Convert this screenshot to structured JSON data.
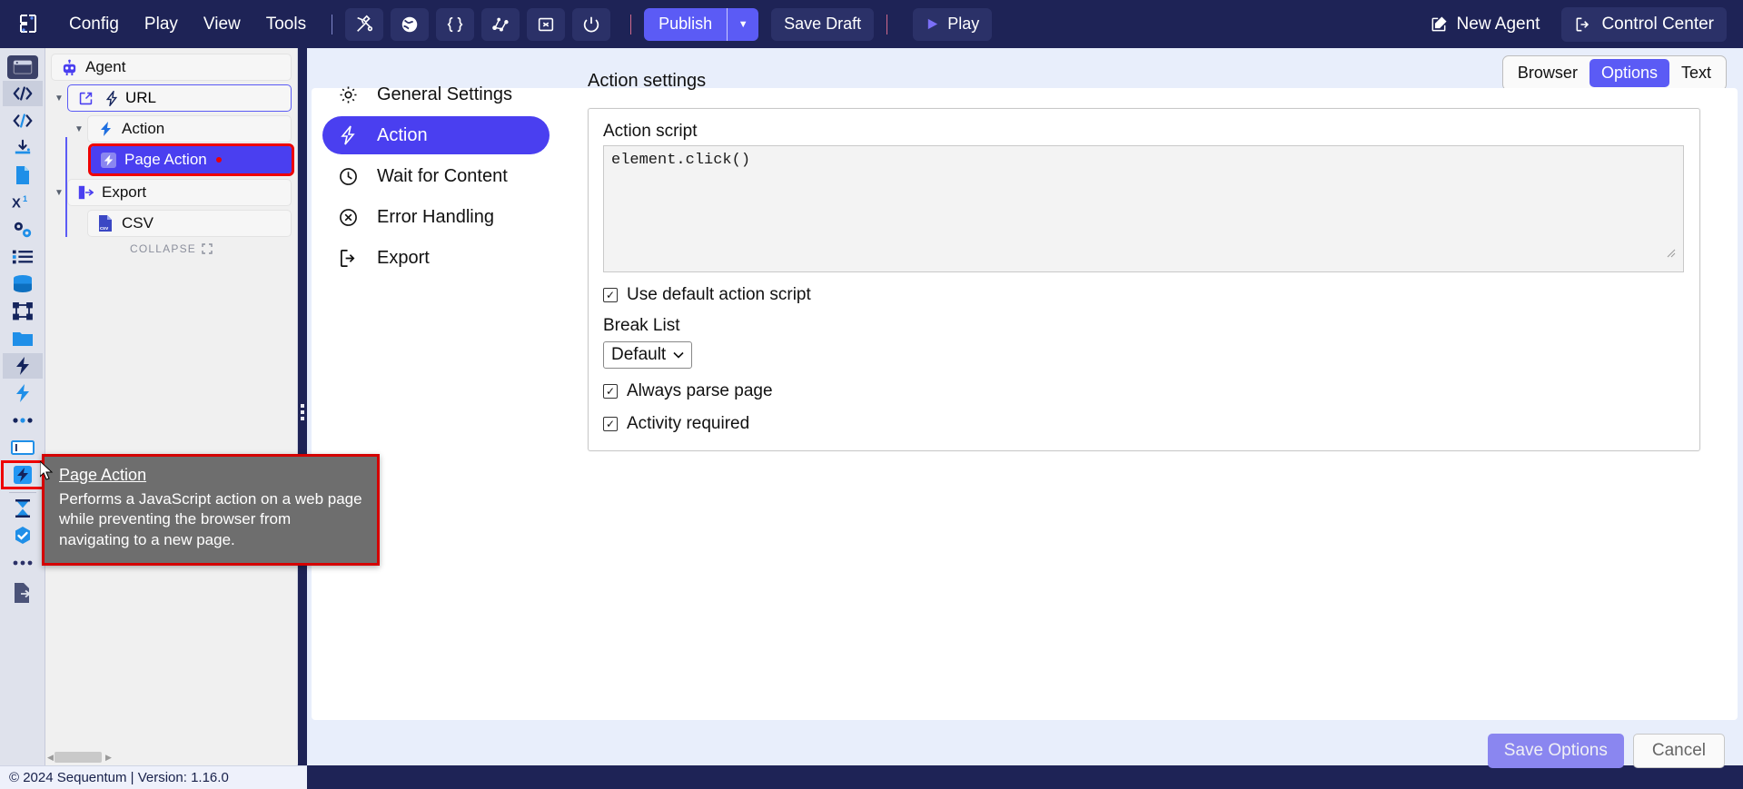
{
  "topbar": {
    "logo_icon": "sequentum-logo-icon",
    "menus": [
      {
        "label": "Config",
        "icon": ""
      },
      {
        "label": "Play",
        "icon": ""
      },
      {
        "label": "View",
        "icon": ""
      },
      {
        "label": "Tools",
        "icon": ""
      }
    ],
    "icon_buttons": [
      {
        "name": "tools-wrench-icon",
        "glyph": "tools"
      },
      {
        "name": "globe-icon",
        "glyph": "globe"
      },
      {
        "name": "code-braces-icon",
        "glyph": "braces"
      },
      {
        "name": "share-nodes-icon",
        "glyph": "nodes"
      },
      {
        "name": "export-box-icon",
        "glyph": "boxx"
      },
      {
        "name": "power-icon",
        "glyph": "power"
      }
    ],
    "publish": {
      "label": "Publish",
      "caret_icon": "chevron-down-icon"
    },
    "save_draft": {
      "label": "Save Draft"
    },
    "play": {
      "label": "Play",
      "icon": "play-triangle-icon"
    },
    "new_agent": {
      "label": "New Agent",
      "icon": "pencil-square-icon"
    },
    "control_center": {
      "label": "Control Center",
      "icon": "external-link-icon"
    }
  },
  "rail": {
    "items": [
      {
        "name": "rail-browser-window-icon",
        "glyph": "window",
        "state": "dark"
      },
      {
        "name": "rail-code-icon",
        "glyph": "code",
        "state": "selected"
      },
      {
        "name": "rail-code-blue-icon",
        "glyph": "code-blue",
        "state": "normal"
      },
      {
        "name": "rail-download-icon",
        "glyph": "download",
        "state": "normal"
      },
      {
        "name": "rail-file-icon",
        "glyph": "file",
        "state": "normal"
      },
      {
        "name": "rail-xpath-icon",
        "glyph": "xpath",
        "state": "normal"
      },
      {
        "name": "rail-settings-gears-icon",
        "glyph": "gears",
        "state": "normal"
      },
      {
        "name": "rail-list-icon",
        "glyph": "list",
        "state": "normal"
      },
      {
        "name": "rail-database-icon",
        "glyph": "database",
        "state": "normal"
      },
      {
        "name": "rail-selection-box-icon",
        "glyph": "selbox",
        "state": "normal"
      },
      {
        "name": "rail-folder-icon",
        "glyph": "folder",
        "state": "normal"
      },
      {
        "name": "rail-action-dark-icon",
        "glyph": "bolt-dark",
        "state": "selected"
      },
      {
        "name": "rail-action-blue-icon",
        "glyph": "bolt-blue",
        "state": "normal"
      },
      {
        "name": "rail-more-dots-icon",
        "glyph": "dots",
        "state": "normal"
      },
      {
        "name": "rail-input-field-icon",
        "glyph": "inputfield",
        "state": "normal"
      },
      {
        "name": "rail-page-action-icon",
        "glyph": "bolt-tile",
        "state": "highlight"
      },
      {
        "name": "rail-hourglass-icon",
        "glyph": "hourglass",
        "state": "normal"
      },
      {
        "name": "rail-check-badge-icon",
        "glyph": "checkbadge",
        "state": "normal"
      },
      {
        "name": "rail-ellipsis-icon",
        "glyph": "dots3",
        "state": "normal"
      },
      {
        "name": "rail-export-doc-icon",
        "glyph": "exportdoc",
        "state": "normal"
      }
    ]
  },
  "tree": {
    "root": {
      "label": "Agent",
      "icon": "robot-icon"
    },
    "nodes": [
      {
        "label": "URL",
        "icon": "external-link-icon",
        "icon2": "bolt-outline-icon",
        "level": 1,
        "expanded": true,
        "style": "url"
      },
      {
        "label": "Action",
        "icon": "bolt-blue-icon",
        "level": 2,
        "expanded": true,
        "style": "plain"
      },
      {
        "label": "Page Action",
        "icon": "page-action-icon",
        "level": 3,
        "expanded": false,
        "style": "selected",
        "modified": true
      },
      {
        "label": "Export",
        "icon": "export-icon",
        "level": 1,
        "expanded": true,
        "style": "plain"
      },
      {
        "label": "CSV",
        "icon": "csv-file-icon",
        "level": 2,
        "expanded": false,
        "style": "plain"
      }
    ],
    "collapse_label": "COLLAPSE",
    "collapse_icon": "collapse-icon"
  },
  "tooltip": {
    "title": "Page Action",
    "body": "Performs a JavaScript action on a web page while preventing the browser from navigating to a new page."
  },
  "view_tabs": {
    "items": [
      {
        "label": "Browser",
        "active": false
      },
      {
        "label": "Options",
        "active": true
      },
      {
        "label": "Text",
        "active": false
      }
    ]
  },
  "settings_menu": {
    "items": [
      {
        "label": "General Settings",
        "icon": "gear-icon",
        "active": false
      },
      {
        "label": "Action",
        "icon": "bolt-icon",
        "active": true
      },
      {
        "label": "Wait for Content",
        "icon": "clock-icon",
        "active": false
      },
      {
        "label": "Error Handling",
        "icon": "error-circle-icon",
        "active": false
      },
      {
        "label": "Export",
        "icon": "export-arrow-icon",
        "active": false
      }
    ]
  },
  "action_settings": {
    "title": "Action settings",
    "script_label": "Action script",
    "script_value": "element.click()",
    "checkboxes": [
      {
        "label": "Use default action script",
        "checked": true
      },
      {
        "label": "Always parse page",
        "checked": true
      },
      {
        "label": "Activity required",
        "checked": true
      }
    ],
    "break_list": {
      "label": "Break List",
      "value": "Default",
      "options": [
        "Default"
      ],
      "caret_icon": "chevron-down-icon"
    }
  },
  "footer": {
    "save_options": "Save Options",
    "cancel": "Cancel"
  },
  "statusbar": {
    "text": "© 2024 Sequentum | Version: 1.16.0"
  },
  "colors": {
    "navy": "#1e2356",
    "accent": "#5b5bf5",
    "selection": "#4a3ff0",
    "highlight_red": "#ee0000",
    "rail_bg": "#dfe2ec",
    "panel_bg": "#e8eefb"
  }
}
